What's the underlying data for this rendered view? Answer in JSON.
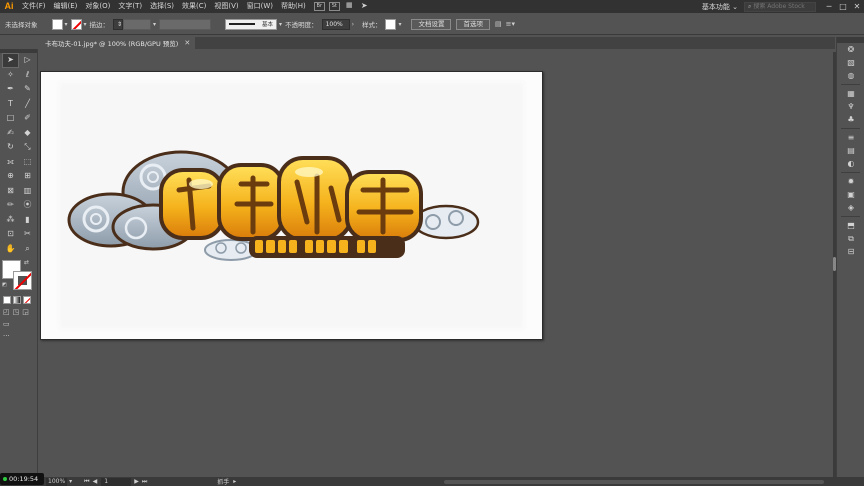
{
  "app": {
    "logo": "Ai",
    "brand_color": "#ff9a00"
  },
  "menu": {
    "items": [
      "文件(F)",
      "编辑(E)",
      "对象(O)",
      "文字(T)",
      "选择(S)",
      "效果(C)",
      "视图(V)",
      "窗口(W)",
      "帮助(H)"
    ],
    "bridge_label": "Br",
    "stock_label": "St"
  },
  "workspace": {
    "label": "基本功能",
    "search_placeholder": "搜索 Adobe Stock"
  },
  "window_controls": {
    "minimize": "─",
    "maximize": "□",
    "close": "✕"
  },
  "control": {
    "selection_status": "未选择对象",
    "stroke_label": "描边：",
    "stroke_style": "基本",
    "opacity_label": "不透明度：",
    "opacity_value": "100%",
    "style_label": "样式：",
    "doc_settings": "文档设置",
    "preferences": "首选项"
  },
  "document": {
    "tab_title": "卡布功夫-01.jpg* @ 100% (RGB/GPU 预览)",
    "tab_close": "✕"
  },
  "status": {
    "timer": "00:19:54",
    "zoom": "100%",
    "page": "1",
    "tool_name": "抓手"
  },
  "icons": {
    "left_tools": [
      "selection-arrow-icon",
      "direct-selection-icon",
      "magic-wand-icon",
      "lasso-icon",
      "pen-icon",
      "curvature-icon",
      "type-icon",
      "line-icon",
      "rectangle-icon",
      "paintbrush-icon",
      "shaper-icon",
      "eraser-icon",
      "rotate-icon",
      "scale-icon",
      "width-icon",
      "free-transform-icon",
      "shape-builder-icon",
      "perspective-icon",
      "mesh-icon",
      "gradient-icon",
      "eyedropper-icon",
      "blend-icon",
      "symbol-sprayer-icon",
      "graph-icon",
      "artboard-icon",
      "slice-icon",
      "hand-icon",
      "zoom-icon"
    ],
    "right_dock": [
      "color-guide-icon",
      "libraries-icon",
      "color-icon",
      "swatches-icon",
      "brushes-icon",
      "symbols-icon",
      "stroke-icon",
      "gradient-icon",
      "transparency-icon",
      "appearance-icon",
      "graphic-styles-icon",
      "layers-icon",
      "artboards-icon",
      "links-icon",
      "align-icon",
      "pathfinder-icon",
      "transform-icon"
    ]
  }
}
